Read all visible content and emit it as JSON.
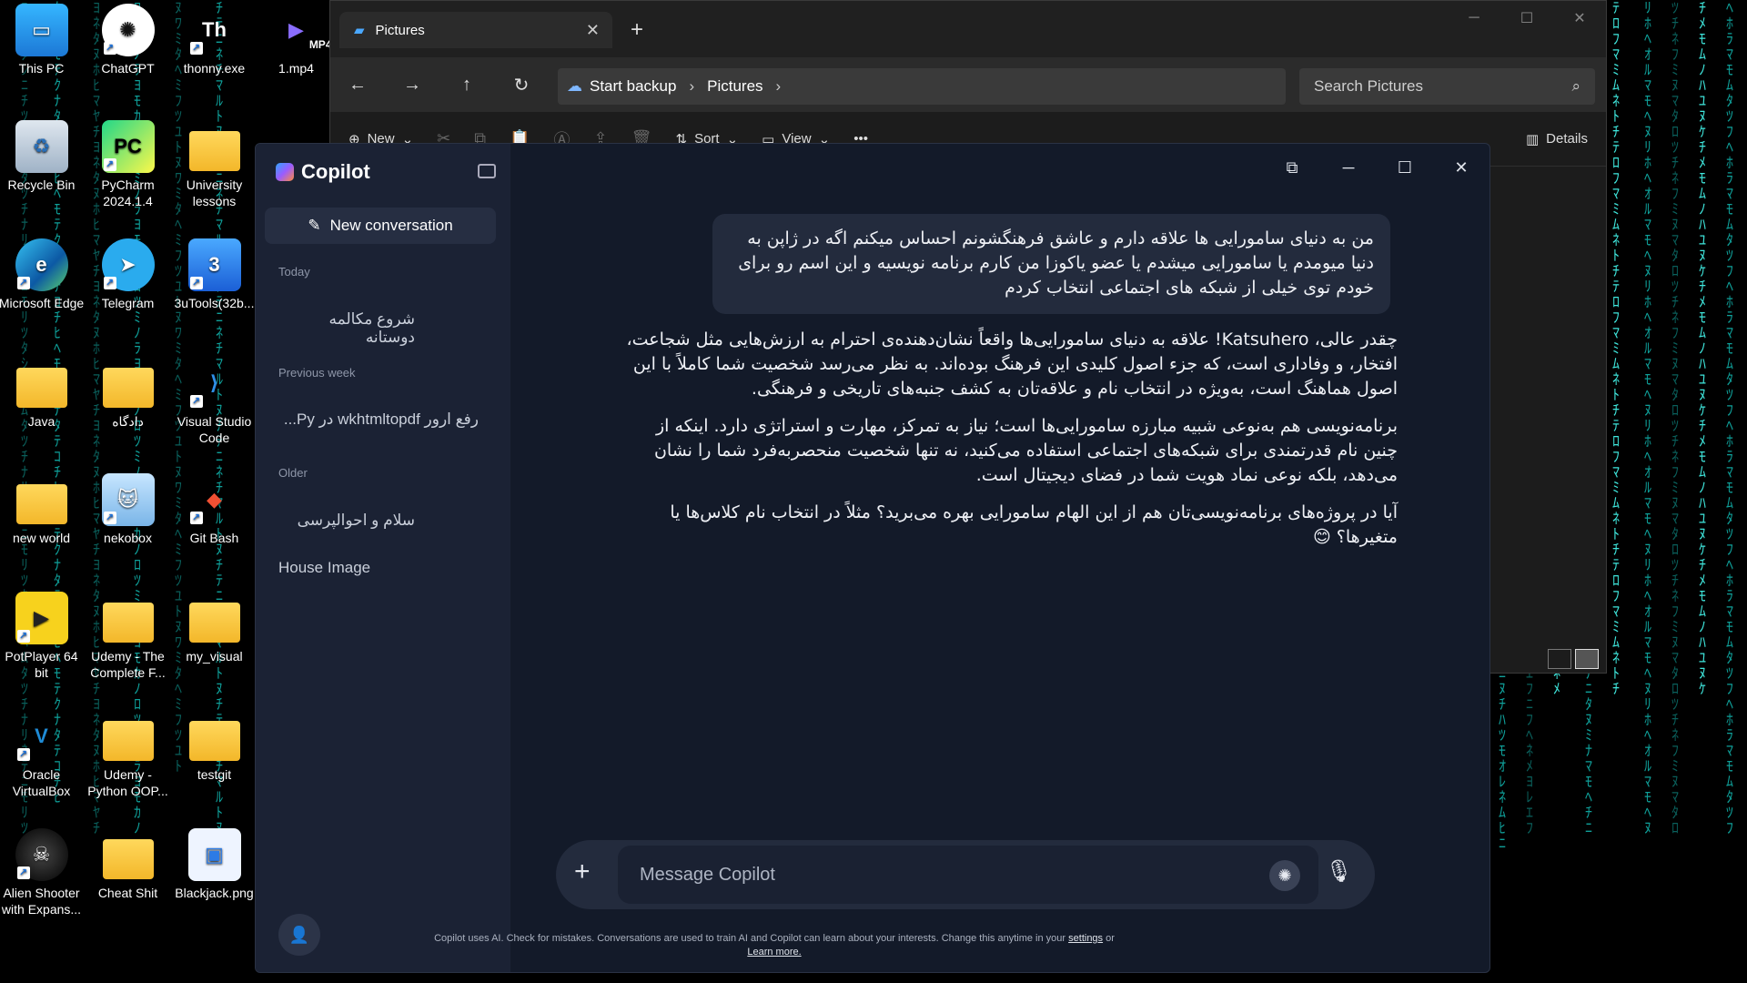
{
  "desktop": {
    "icons": [
      {
        "label": "This PC",
        "icon": "pc-icon"
      },
      {
        "label": "ChatGPT",
        "icon": "chatgpt-icon"
      },
      {
        "label": "thonny.exe",
        "icon": "thonny-icon"
      },
      {
        "label": "1.mp4",
        "icon": "video-icon",
        "badge": "MP4"
      },
      {
        "label": "Recycle Bin",
        "icon": "recycle-bin-icon"
      },
      {
        "label": "PyCharm 2024.1.4",
        "icon": "pycharm-icon"
      },
      {
        "label": "University lessons",
        "icon": "folder-icon"
      },
      {
        "label": "Microsoft Edge",
        "icon": "edge-icon"
      },
      {
        "label": "Telegram",
        "icon": "telegram-icon"
      },
      {
        "label": "3uTools(32b...",
        "icon": "3utools-icon"
      },
      {
        "label": "Java",
        "icon": "folder-icon"
      },
      {
        "label": "دادگاه",
        "icon": "folder-icon"
      },
      {
        "label": "Visual Studio Code",
        "icon": "vscode-icon"
      },
      {
        "label": "new world",
        "icon": "folder-icon"
      },
      {
        "label": "nekobox",
        "icon": "nekobox-icon"
      },
      {
        "label": "Git Bash",
        "icon": "git-icon"
      },
      {
        "label": "PotPlayer 64 bit",
        "icon": "potplayer-icon"
      },
      {
        "label": "Udemy - The Complete F...",
        "icon": "folder-icon"
      },
      {
        "label": "my_visual",
        "icon": "folder-icon"
      },
      {
        "label": "Oracle VirtualBox",
        "icon": "virtualbox-icon"
      },
      {
        "label": "Udemy - Python OOP...",
        "icon": "folder-icon"
      },
      {
        "label": "testgit",
        "icon": "folder-icon"
      },
      {
        "label": "Alien Shooter with Expans...",
        "icon": "alien-shooter-icon"
      },
      {
        "label": "Cheat Shit",
        "icon": "folder-icon"
      },
      {
        "label": "Blackjack.png",
        "icon": "image-file-icon"
      }
    ]
  },
  "explorer": {
    "tab_title": "Pictures",
    "breadcrumb": [
      "Start backup",
      "Pictures"
    ],
    "search_placeholder": "Search Pictures",
    "toolbar": {
      "new": "New",
      "sort": "Sort",
      "view": "View",
      "more": "•••",
      "details": "Details"
    }
  },
  "copilot": {
    "brand": "Copilot",
    "new_conversation": "New conversation",
    "sections": {
      "today": "Today",
      "previous_week": "Previous week",
      "older": "Older"
    },
    "conversations": {
      "today": [
        "شروع مکالمه دوستانه"
      ],
      "previous_week": [
        "رفع ارور wkhtmltopdf در Py..."
      ],
      "older": [
        "سلام و احوالپرسی",
        "House Image"
      ]
    },
    "user_message": "من به دنیای سامورایی ها علاقه دارم و عاشق فرهنگشونم احساس میکنم اگه در ژاپن به دنیا میومدم یا سامورایی میشدم یا عضو یاکوزا من کارم برنامه نویسیه و این اسم رو برای خودم توی خیلی از شبکه های اجتماعی انتخاب کردم",
    "assistant_paragraphs": [
      "چقدر عالی، Katsuhero! علاقه به دنیای سامورایی‌ها واقعاً نشان‌دهنده‌ی احترام به ارزش‌هایی مثل شجاعت، افتخار، و وفاداری است، که جزء اصول کلیدی این فرهنگ بوده‌اند. به نظر می‌رسد شخصیت شما کاملاً با این اصول هماهنگ است، به‌ویژه در انتخاب نام و علاقه‌تان به کشف جنبه‌های تاریخی و فرهنگی.",
      "برنامه‌نویسی هم به‌نوعی شبیه مبارزه سامورایی‌ها است؛ نیاز به تمرکز، مهارت و استراتژی دارد. اینکه از چنین نام قدرتمندی برای شبکه‌های اجتماعی استفاده می‌کنید، نه تنها شخصیت منحصربه‌فرد شما را نشان می‌دهد، بلکه نوعی نماد هویت شما در فضای دیجیتال است.",
      "آیا در پروژه‌های برنامه‌نویسی‌تان هم از این الهام سامورایی بهره می‌برید؟ مثلاً در انتخاب نام کلاس‌ها یا متغیرها؟ 😊"
    ],
    "composer_placeholder": "Message Copilot",
    "disclaimer_text": "Copilot uses AI. Check for mistakes. Conversations are used to train AI and Copilot can learn about your interests. Change this anytime in your",
    "disclaimer_settings": "settings",
    "disclaimer_or": "or",
    "disclaimer_learn": "Learn more."
  },
  "colors": {
    "matrix": "#0fa09a",
    "copilot_bg": "#131a29",
    "copilot_sidebar": "#1b2234",
    "explorer_bg": "#1c1c1c"
  }
}
